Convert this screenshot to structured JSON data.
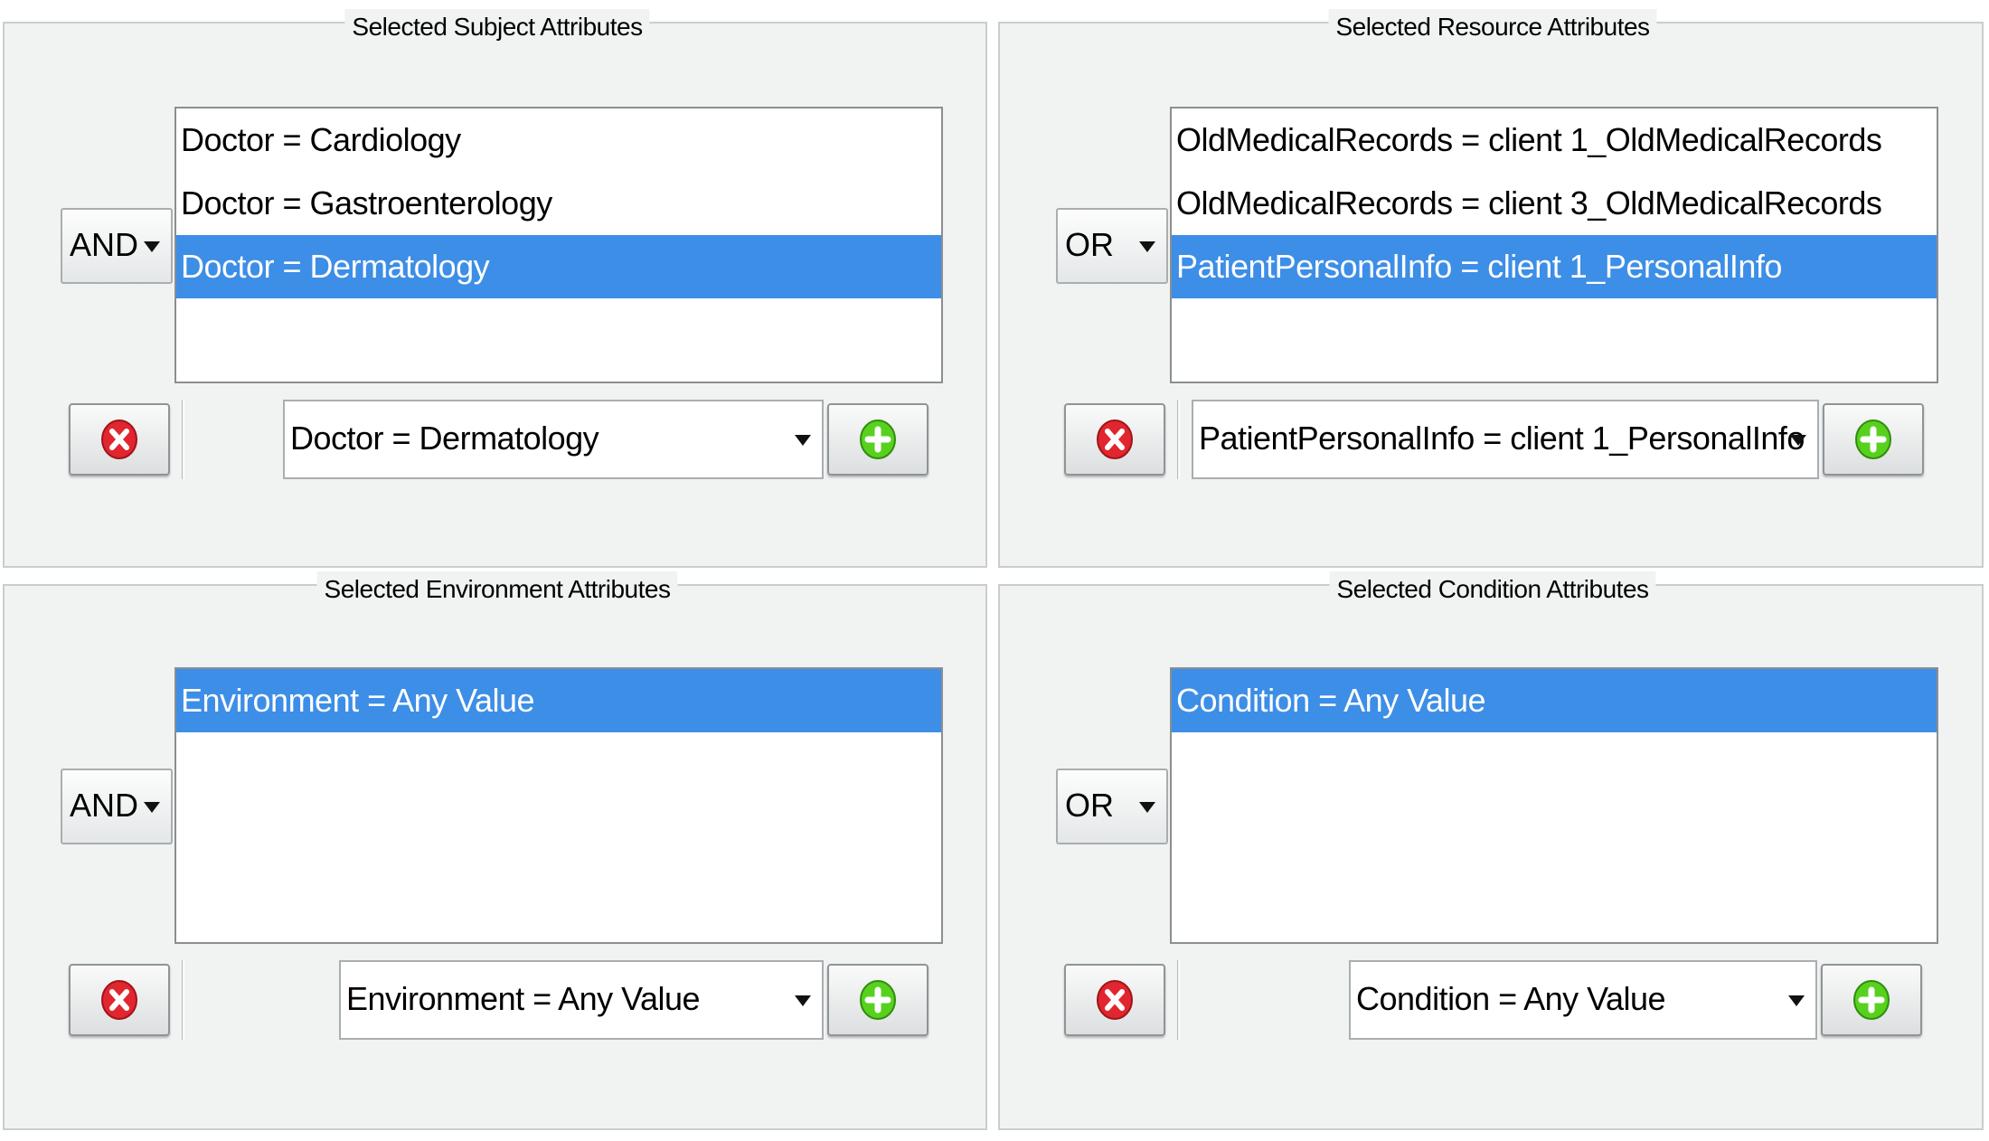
{
  "panels": {
    "subject": {
      "title": "Selected Subject Attributes",
      "operator": "AND",
      "items": [
        "Doctor = Cardiology",
        "Doctor = Gastroenterology",
        "Doctor = Dermatology"
      ],
      "selected_index": 2,
      "combo_value": "Doctor = Dermatology"
    },
    "resource": {
      "title": "Selected Resource Attributes",
      "operator": "OR",
      "items": [
        "OldMedicalRecords = client 1_OldMedicalRecords",
        "OldMedicalRecords = client 3_OldMedicalRecords",
        "PatientPersonalInfo = client 1_PersonalInfo"
      ],
      "selected_index": 2,
      "combo_value": "PatientPersonalInfo = client 1_PersonalInfo"
    },
    "environment": {
      "title": "Selected Environment Attributes",
      "operator": "AND",
      "items": [
        "Environment = Any Value"
      ],
      "selected_index": 0,
      "combo_value": "Environment = Any Value"
    },
    "condition": {
      "title": "Selected Condition Attributes",
      "operator": "OR",
      "items": [
        "Condition = Any Value"
      ],
      "selected_index": 0,
      "combo_value": "Condition = Any Value"
    }
  },
  "icons": {
    "remove": "remove-icon",
    "add": "add-icon",
    "dropdown": "chevron-down-icon"
  },
  "colors": {
    "selection": "#3d8ee6",
    "remove_icon": "#e0262e",
    "add_icon": "#58d11e",
    "panel_bg": "#f1f3f3"
  }
}
